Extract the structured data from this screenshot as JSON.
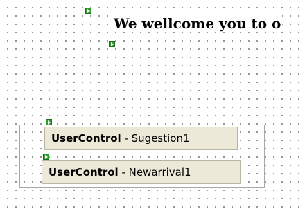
{
  "heading": {
    "text": "We wellcome you to o"
  },
  "controls": [
    {
      "kind": "UserControl",
      "separator": " - ",
      "name": "Sugestion1"
    },
    {
      "kind": "UserControl",
      "separator": " - ",
      "name": "Newarrival1"
    }
  ],
  "icons": {
    "glyph": "run-at-server-glyph-icon"
  },
  "colors": {
    "glyph_green": "#2e9d2e",
    "control_background": "#ece9d8",
    "grid_dot": "#7a7a7a"
  }
}
